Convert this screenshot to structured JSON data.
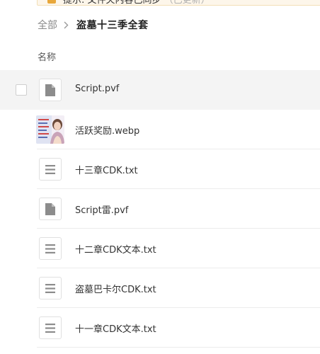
{
  "notice": {
    "text": "提示: 文件夹内容已同步",
    "muted": "（已更新）"
  },
  "breadcrumb": {
    "root": "全部",
    "separator": ">",
    "current": "盗墓十三季全套"
  },
  "table": {
    "name_header": "名称"
  },
  "files": [
    {
      "name": "Script.pvf",
      "icon": "generic-file-icon",
      "hovered": true
    },
    {
      "name": "活跃奖励.webp",
      "icon": "image-thumbnail",
      "hovered": false
    },
    {
      "name": "十三章CDK.txt",
      "icon": "text-file-icon",
      "hovered": false
    },
    {
      "name": "Script雷.pvf",
      "icon": "generic-file-icon",
      "hovered": false
    },
    {
      "name": "十二章CDK文本.txt",
      "icon": "text-file-icon",
      "hovered": false
    },
    {
      "name": "盗墓巴卡尔CDK.txt",
      "icon": "text-file-icon",
      "hovered": false
    },
    {
      "name": "十一章CDK文本.txt",
      "icon": "text-file-icon",
      "hovered": false
    }
  ],
  "colors": {
    "hover_row": "#f4f4f4",
    "divider": "#ececec",
    "icon_gray": "#8c8c8c",
    "notice_bg": "#fdf6ea"
  }
}
